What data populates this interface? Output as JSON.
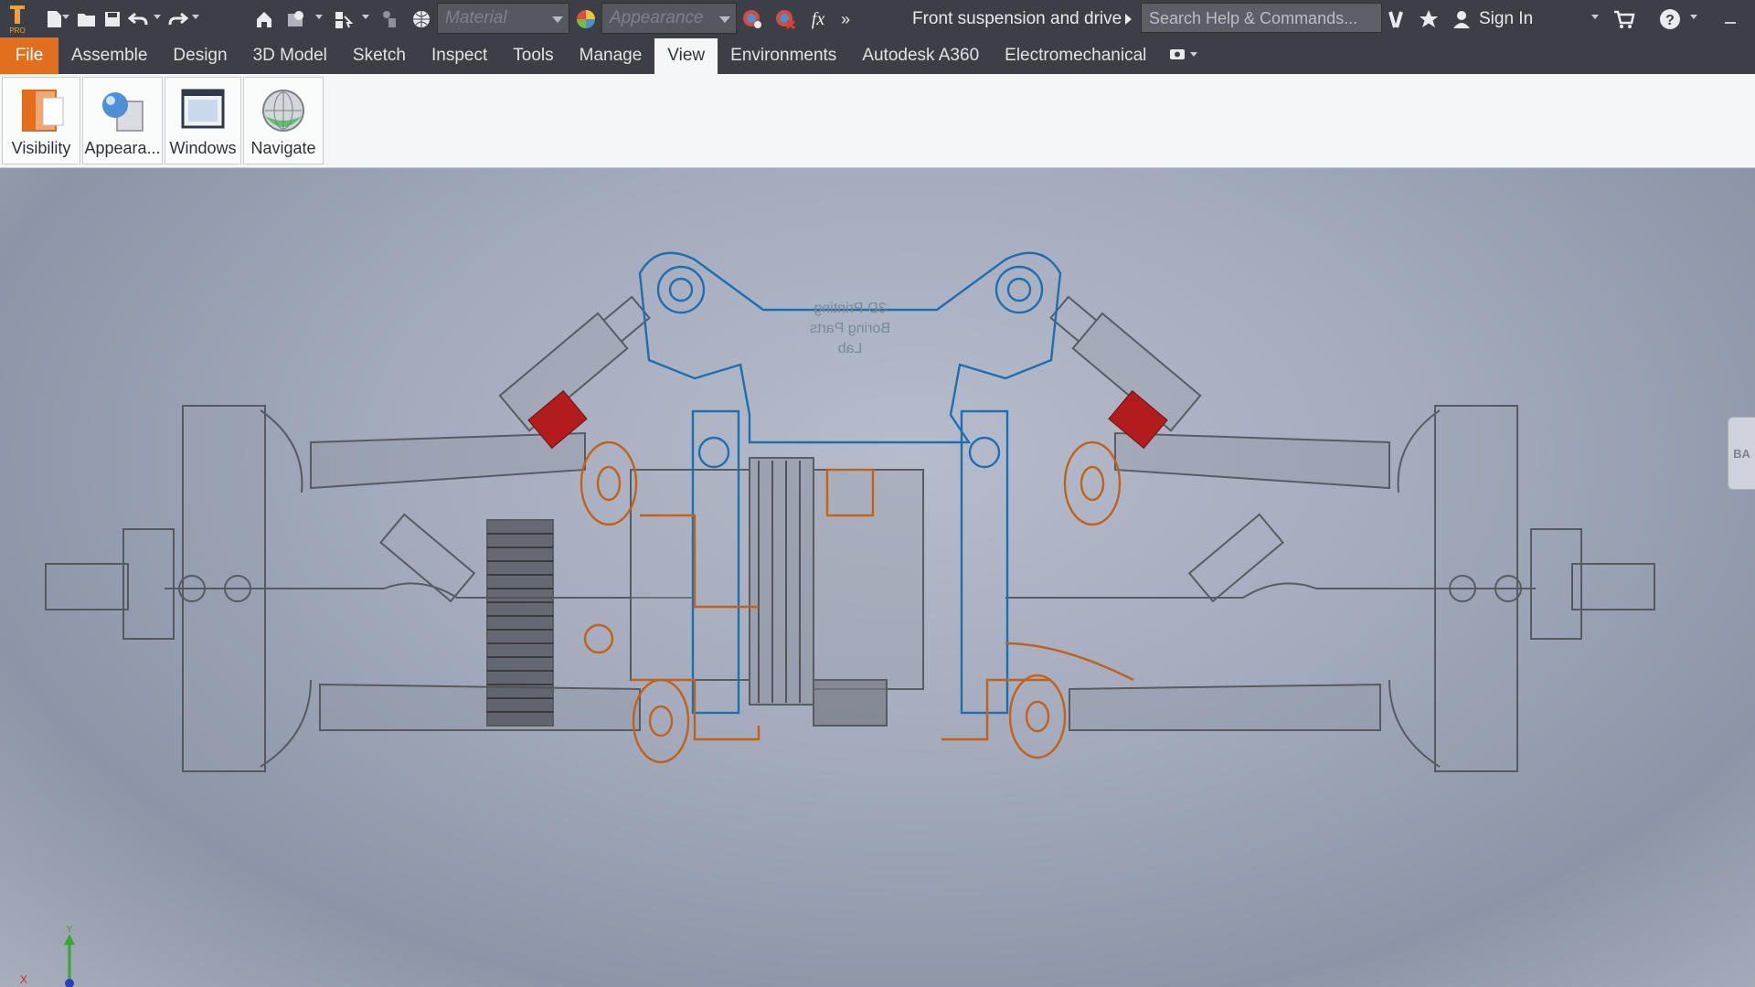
{
  "app": {
    "logo_text": "PRO"
  },
  "titlebar": {
    "material_placeholder": "Material",
    "appearance_placeholder": "Appearance",
    "fx_label": "fx",
    "more_label": "»",
    "document_title": "Front suspension and drive",
    "search_placeholder": "Search Help & Commands...",
    "sign_in_label": "Sign In"
  },
  "menu": {
    "tabs": [
      {
        "label": "File"
      },
      {
        "label": "Assemble"
      },
      {
        "label": "Design"
      },
      {
        "label": "3D Model"
      },
      {
        "label": "Sketch"
      },
      {
        "label": "Inspect"
      },
      {
        "label": "Tools"
      },
      {
        "label": "Manage"
      },
      {
        "label": "View"
      },
      {
        "label": "Environments"
      },
      {
        "label": "Autodesk A360"
      },
      {
        "label": "Electromechanical"
      }
    ],
    "active_tab": "View"
  },
  "ribbon": {
    "buttons": [
      {
        "label": "Visibility",
        "icon": "visibility-icon"
      },
      {
        "label": "Appeara...",
        "icon": "appearance-icon"
      },
      {
        "label": "Windows",
        "icon": "windows-icon"
      },
      {
        "label": "Navigate",
        "icon": "navigate-icon"
      }
    ]
  },
  "viewport": {
    "engraved_text": [
      "3D Printing",
      "Boring Parts",
      "Lab"
    ],
    "viewcube_label": "BA",
    "axis": {
      "y_label": "Y",
      "x_label": "X"
    }
  },
  "colors": {
    "accent": "#e36f1e",
    "titlebar": "#3c4046",
    "blue_sketch": "#1f6fb0",
    "orange_sketch": "#c2621a",
    "red_spring": "#b31c1c"
  }
}
